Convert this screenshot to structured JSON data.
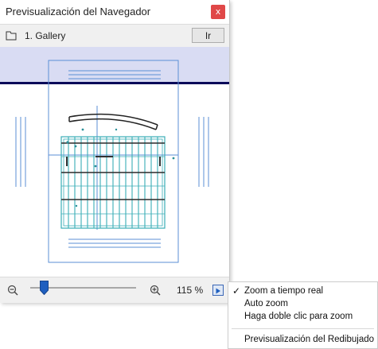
{
  "window": {
    "title": "Previsualización del Navegador",
    "close_glyph": "x",
    "close_color": "#e04848"
  },
  "viewbar": {
    "view_icon": "view-icon",
    "view_label": "1. Gallery",
    "go_label": "Ir"
  },
  "preview": {
    "band_color": "#d9dcf3",
    "horizon_color": "#0b0b5a",
    "drawing_color": "#3aaeb6",
    "frame_color": "#5b8fd6"
  },
  "zoombar": {
    "zoom_out_icon": "zoom-out-icon",
    "zoom_in_icon": "zoom-in-icon",
    "slider_level_percent": 12,
    "zoom_value": "115 %",
    "menu_icon": "play-arrow-icon",
    "accent": "#1f5fbf"
  },
  "menu": {
    "items": [
      {
        "label": "Zoom a tiempo real",
        "checked": true
      },
      {
        "label": "Auto zoom",
        "checked": false
      },
      {
        "label": "Haga doble clic para zoom",
        "checked": false
      },
      {
        "label": "Previsualización del Redibujado",
        "checked": false
      }
    ],
    "check_glyph": "✓"
  }
}
